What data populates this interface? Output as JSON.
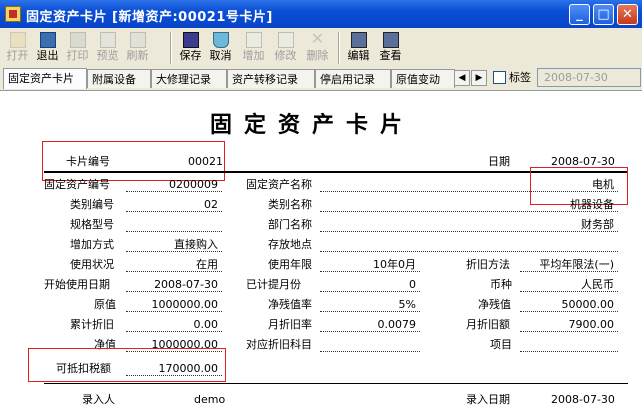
{
  "window": {
    "title": "固定资产卡片 [新增资产:00021号卡片]",
    "accent": "#0a4fd6",
    "controls": [
      "minimize",
      "maximize",
      "close"
    ]
  },
  "toolbar": {
    "open": "打开",
    "exit": "退出",
    "print": "打印",
    "preview": "预览",
    "refresh": "刷新",
    "save": "保存",
    "cancel": "取消",
    "add": "增加",
    "edit": "修改",
    "delete": "删除",
    "compile": "编辑",
    "view": "查看"
  },
  "tabs": [
    "固定资产卡片",
    "附属设备",
    "大修理记录",
    "资产转移记录",
    "停启用记录",
    "原值变动"
  ],
  "tag_label": "标签",
  "tag_date": "2008-07-30",
  "card": {
    "title": "固定资产卡片",
    "card_no_label": "卡片编号",
    "card_no": "00021",
    "date_label": "日期",
    "date": "2008-07-30",
    "asset_code_label": "固定资产编号",
    "asset_code": "0200009",
    "asset_name_label": "固定资产名称",
    "asset_name": "电机",
    "category_code_label": "类别编号",
    "category_code": "02",
    "category_name_label": "类别名称",
    "category_name": "机器设备",
    "spec_label": "规格型号",
    "spec": "",
    "dept_label": "部门名称",
    "dept": "财务部",
    "add_method_label": "增加方式",
    "add_method": "直接购入",
    "location_label": "存放地点",
    "location": "",
    "usage_label": "使用状况",
    "usage": "在用",
    "life_label": "使用年限",
    "life": "10年0月",
    "dep_method_label": "折旧方法",
    "dep_method": "平均年限法(一)",
    "start_date_label": "开始使用日期",
    "start_date": "2008-07-30",
    "months_label": "已计提月份",
    "months": "0",
    "currency_label": "币种",
    "currency": "人民币",
    "orig_value_label": "原值",
    "orig_value": "1000000.00",
    "salvage_rate_label": "净残值率",
    "salvage_rate": "5%",
    "salvage_label": "净残值",
    "salvage": "50000.00",
    "acc_dep_label": "累计折旧",
    "acc_dep": "0.00",
    "month_rate_label": "月折旧率",
    "month_rate": "0.0079",
    "month_amt_label": "月折旧额",
    "month_amt": "7900.00",
    "net_label": "净值",
    "net": "1000000.00",
    "dep_subject_label": "对应折旧科目",
    "dep_subject": "",
    "project_label": "项目",
    "project": "",
    "tax_label": "可抵扣税额",
    "tax": "170000.00",
    "entry_person_label": "录入人",
    "entry_person": "demo",
    "entry_date_label": "录入日期",
    "entry_date": "2008-07-30"
  }
}
